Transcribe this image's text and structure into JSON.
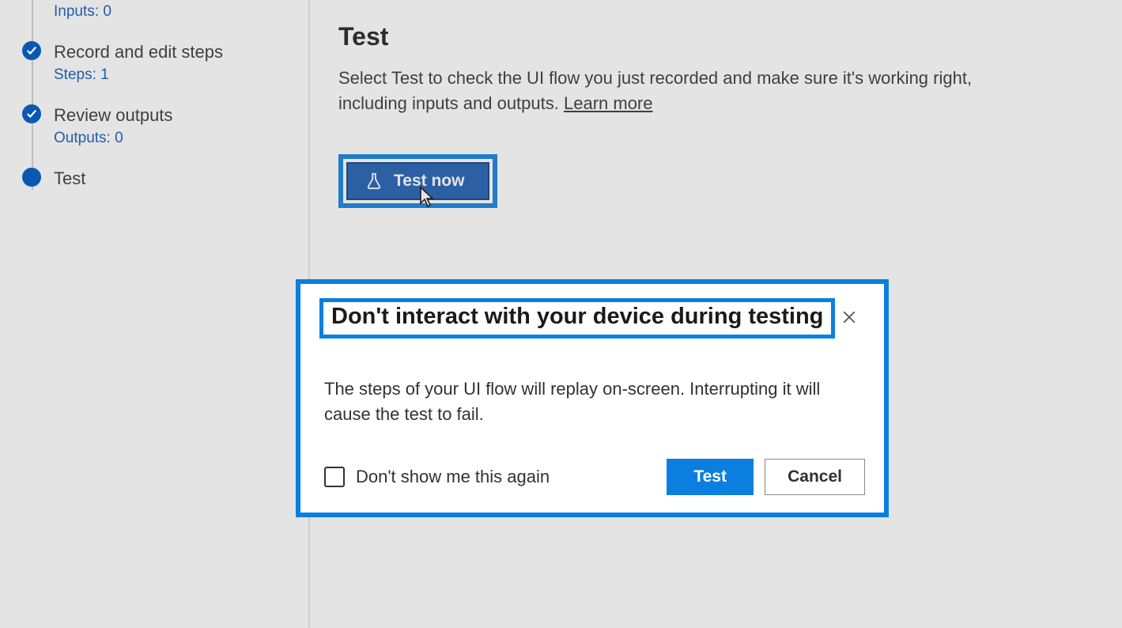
{
  "sidebar": {
    "steps": [
      {
        "title": "",
        "sub": "Inputs: 0",
        "state": "done-offscreen"
      },
      {
        "title": "Record and edit steps",
        "sub": "Steps: 1",
        "state": "done"
      },
      {
        "title": "Review outputs",
        "sub": "Outputs: 0",
        "state": "done"
      },
      {
        "title": "Test",
        "sub": "",
        "state": "current"
      }
    ]
  },
  "main": {
    "title": "Test",
    "description": "Select Test to check the UI flow you just recorded and make sure it's working right, including inputs and outputs. ",
    "learn_more": "Learn more",
    "test_now_label": "Test now"
  },
  "modal": {
    "title": "Don't interact with your device during testing",
    "body": "The steps of your UI flow will replay on-screen. Interrupting it will cause the test to fail.",
    "dont_show_label": "Don't show me this again",
    "test_label": "Test",
    "cancel_label": "Cancel"
  },
  "icons": {
    "check": "check-icon",
    "flask": "flask-icon",
    "close": "close-icon",
    "cursor": "cursor-icon"
  }
}
